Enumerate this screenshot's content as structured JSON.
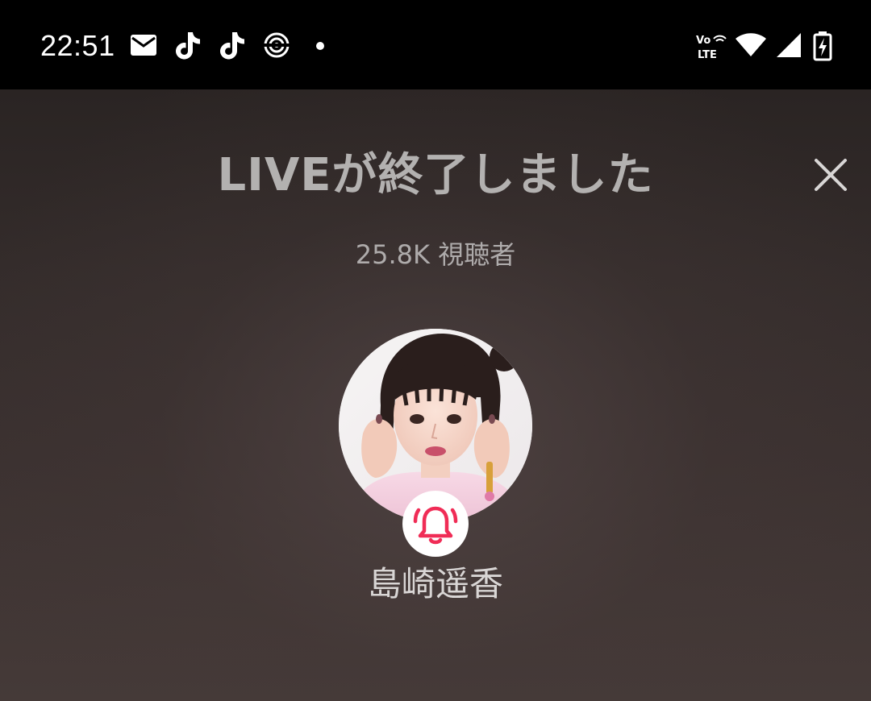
{
  "status_bar": {
    "time": "22:51",
    "network_label": "Vo LTE",
    "notification_icons": [
      "mail-icon",
      "tiktok-icon",
      "tiktok-icon",
      "hotspot-icon",
      "dot-icon"
    ],
    "system_icons": [
      "volte-icon",
      "wifi-icon",
      "cell-signal-icon",
      "battery-charging-icon"
    ]
  },
  "live_end": {
    "title": "LIVEが終了しました",
    "viewer_count": "25.8K 視聴者",
    "streamer_name": "島崎遥香",
    "close_icon": "close-icon",
    "notify_icon": "bell-ringing-icon"
  },
  "colors": {
    "accent": "#f02c56",
    "title_text": "#b3b1b0",
    "name_text": "#d9d6d5"
  }
}
